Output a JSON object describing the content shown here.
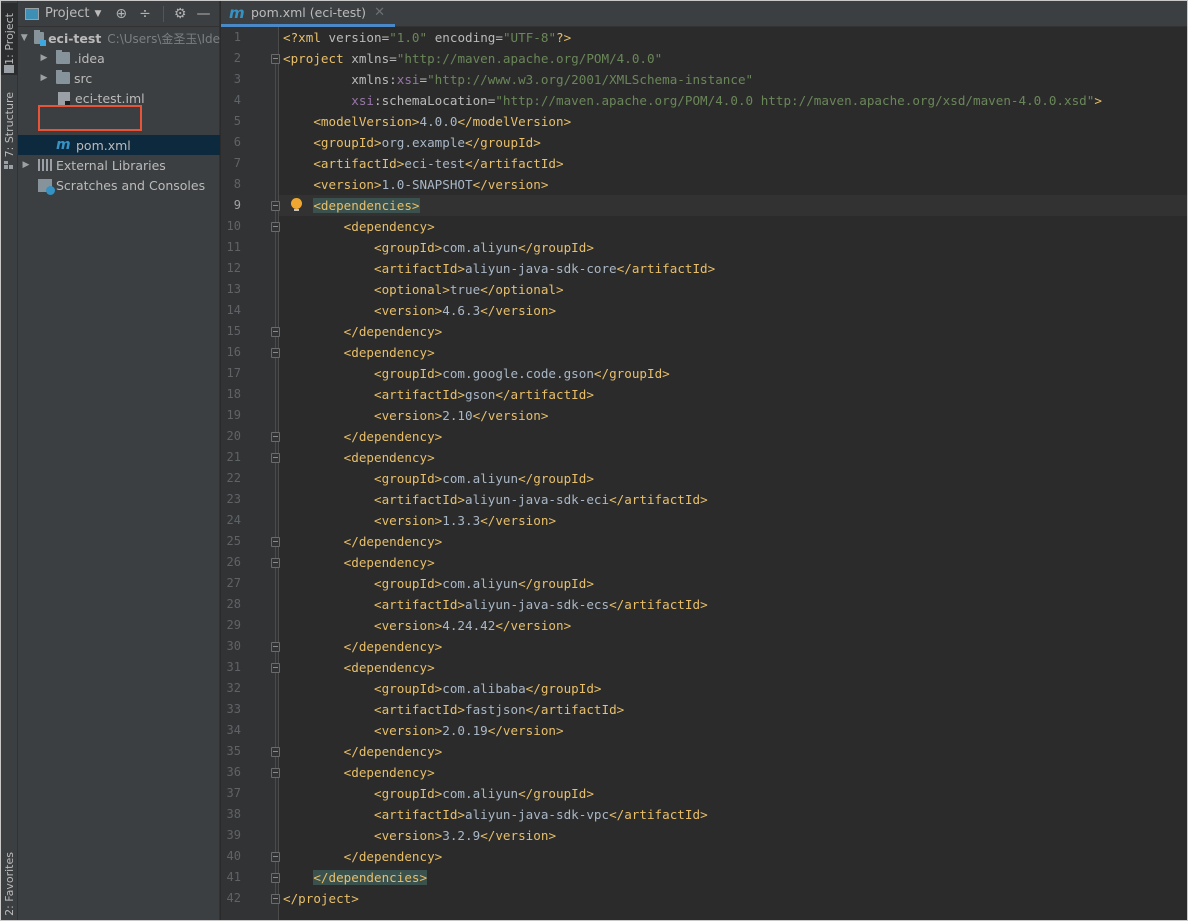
{
  "left_strip": {
    "project_label": "1: Project",
    "structure_label": "7: Structure",
    "favorites_label": "2: Favorites"
  },
  "project_panel": {
    "title": "Project",
    "toolbar_icons": [
      "locate-icon",
      "collapse-all-icon",
      "gear-icon",
      "minimize-icon"
    ],
    "tree": [
      {
        "label": "eci-test",
        "path": "C:\\Users\\金圣玉\\Ide",
        "type": "module",
        "expanded": true,
        "level": 0
      },
      {
        "label": ".idea",
        "type": "folder",
        "expanded": false,
        "level": 1
      },
      {
        "label": "src",
        "type": "folder",
        "expanded": false,
        "level": 1
      },
      {
        "label": "eci-test.iml",
        "type": "iml-file",
        "level": 1
      },
      {
        "label": "pom.xml",
        "type": "maven-file",
        "level": 1,
        "selected": true
      },
      {
        "label": "External Libraries",
        "type": "libraries",
        "expanded": false,
        "level": 0
      },
      {
        "label": "Scratches and Consoles",
        "type": "scratches",
        "level": 0
      }
    ]
  },
  "editor": {
    "tab": {
      "label": "pom.xml (eci-test)",
      "icon": "maven-icon"
    },
    "current_line": 9,
    "lines": [
      "<?xml version=\"1.0\" encoding=\"UTF-8\"?>",
      "<project xmlns=\"http://maven.apache.org/POM/4.0.0\"",
      "         xmlns:xsi=\"http://www.w3.org/2001/XMLSchema-instance\"",
      "         xsi:schemaLocation=\"http://maven.apache.org/POM/4.0.0 http://maven.apache.org/xsd/maven-4.0.0.xsd\">",
      "    <modelVersion>4.0.0</modelVersion>",
      "    <groupId>org.example</groupId>",
      "    <artifactId>eci-test</artifactId>",
      "    <version>1.0-SNAPSHOT</version>",
      "    <dependencies>",
      "        <dependency>",
      "            <groupId>com.aliyun</groupId>",
      "            <artifactId>aliyun-java-sdk-core</artifactId>",
      "            <optional>true</optional>",
      "            <version>4.6.3</version>",
      "        </dependency>",
      "        <dependency>",
      "            <groupId>com.google.code.gson</groupId>",
      "            <artifactId>gson</artifactId>",
      "            <version>2.10</version>",
      "        </dependency>",
      "        <dependency>",
      "            <groupId>com.aliyun</groupId>",
      "            <artifactId>aliyun-java-sdk-eci</artifactId>",
      "            <version>1.3.3</version>",
      "        </dependency>",
      "        <dependency>",
      "            <groupId>com.aliyun</groupId>",
      "            <artifactId>aliyun-java-sdk-ecs</artifactId>",
      "            <version>4.24.42</version>",
      "        </dependency>",
      "        <dependency>",
      "            <groupId>com.alibaba</groupId>",
      "            <artifactId>fastjson</artifactId>",
      "            <version>2.0.19</version>",
      "        </dependency>",
      "        <dependency>",
      "            <groupId>com.aliyun</groupId>",
      "            <artifactId>aliyun-java-sdk-vpc</artifactId>",
      "            <version>3.2.9</version>",
      "        </dependency>",
      "    </dependencies>",
      "</project>"
    ]
  },
  "colors": {
    "tag": "#e8bf6a",
    "attr_value": "#6a8759",
    "namespace": "#9876aa",
    "text": "#a9b7c6",
    "selection": "#0d293e",
    "highlight_box": "#e8543a",
    "tag_match": "#3b514d"
  }
}
